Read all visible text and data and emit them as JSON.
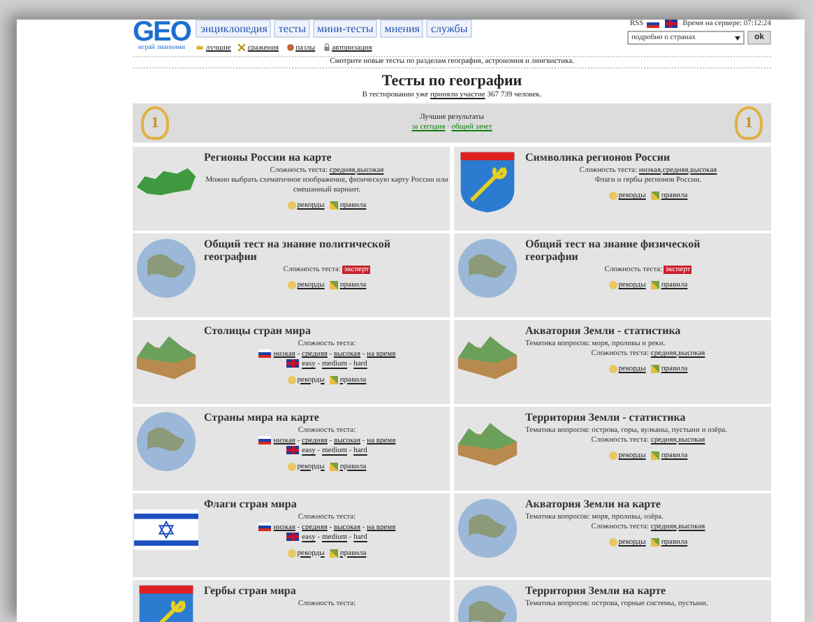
{
  "header": {
    "logo": "GEO",
    "logo_tagline": "играй знаниями",
    "nav": [
      {
        "label": "энциклопедия"
      },
      {
        "label": "тесты"
      },
      {
        "label": "мини-тесты"
      },
      {
        "label": "мнения"
      },
      {
        "label": "службы"
      }
    ],
    "subnav": [
      {
        "kind": "crown",
        "label": "лучшие"
      },
      {
        "kind": "swords",
        "label": "сражения"
      },
      {
        "kind": "puzzle",
        "label": "пазлы"
      },
      {
        "kind": "lock",
        "label": "авторизация"
      }
    ],
    "rss": "RSS",
    "server_time": "Время на сервере: 07:12:24",
    "country_select": "подробно о странах",
    "ok": "ok"
  },
  "notice": "Смотрите новые тесты по разделам география, астрономия и лингвистика.",
  "title": "Тесты по географии",
  "participants": {
    "before": "В тестировании уже",
    "link": "приняли участие",
    "after": "367 739 человек."
  },
  "best_results": {
    "label": "Лучшие результаты",
    "links": [
      "за сегодня",
      "общий зачет"
    ],
    "separator": "·",
    "medals": [
      "1",
      "1"
    ]
  },
  "tests": [
    {
      "kind": "map",
      "title": "Регионы России на карте",
      "difficulty": {
        "kind": "inline",
        "label": "Сложность теста:",
        "separator": ",",
        "links": [
          "средняя",
          "высокая"
        ]
      },
      "note": "Можно выбрать схематичное изображение, физическую карту России или смешанный вариант.",
      "actions": [
        "рекорды",
        "правила"
      ]
    },
    {
      "kind": "emblem",
      "title": "Символика регионов России",
      "difficulty": {
        "kind": "inline",
        "label": "Сложность теста:",
        "separator": ",",
        "links": [
          "низкая",
          "средняя",
          "высокая"
        ]
      },
      "note": "Флаги и гербы регионов России.",
      "actions": [
        "рекорды",
        "правила"
      ]
    },
    {
      "kind": "globe",
      "title": "Общий тест на знание политической географии",
      "difficulty": {
        "kind": "badge",
        "label": "Сложность теста:",
        "links": [
          "эксперт"
        ]
      },
      "actions": [
        "рекорды",
        "правила"
      ]
    },
    {
      "kind": "globe",
      "title": "Общий тест на знание физической географии",
      "difficulty": {
        "kind": "badge",
        "label": "Сложность теста:",
        "links": [
          "эксперт"
        ]
      },
      "actions": [
        "рекорды",
        "правила"
      ]
    },
    {
      "kind": "terrain",
      "title": "Столицы стран мира",
      "difficulty": {
        "kind": "langs",
        "label": "Сложность теста:",
        "rows": [
          {
            "kind": "ru",
            "separator": "-",
            "links": [
              "низкая",
              "средняя",
              "высокая",
              "на время"
            ]
          },
          {
            "kind": "en",
            "separator": "-",
            "links": [
              "easy",
              "medium",
              "hard"
            ]
          }
        ]
      },
      "actions": [
        "рекорды",
        "правила"
      ]
    },
    {
      "kind": "terrain",
      "title": "Акватория Земли - статистика",
      "topics": "Тематика вопросов: моря, проливы и реки.",
      "difficulty": {
        "kind": "inline",
        "label": "Сложность теста:",
        "separator": ",",
        "links": [
          "средняя",
          "высокая"
        ]
      },
      "actions": [
        "рекорды",
        "правила"
      ]
    },
    {
      "kind": "globe",
      "title": "Страны мира на карте",
      "difficulty": {
        "kind": "langs",
        "label": "Сложность теста:",
        "rows": [
          {
            "kind": "ru",
            "separator": "-",
            "links": [
              "низкая",
              "средняя",
              "высокая",
              "на время"
            ]
          },
          {
            "kind": "en",
            "separator": "-",
            "links": [
              "easy",
              "medium",
              "hard"
            ]
          }
        ]
      },
      "actions": [
        "рекорды",
        "правила"
      ]
    },
    {
      "kind": "terrain",
      "title": "Территория Земли - статистика",
      "topics": "Тематика вопросов: острова, горы, вулканы, пустыни и озёра.",
      "difficulty": {
        "kind": "inline",
        "label": "Сложность теста:",
        "separator": ",",
        "links": [
          "средняя",
          "высокая"
        ]
      },
      "actions": [
        "рекорды",
        "правила"
      ]
    },
    {
      "kind": "flag",
      "title": "Флаги стран мира",
      "difficulty": {
        "kind": "langs",
        "label": "Сложность теста:",
        "rows": [
          {
            "kind": "ru",
            "separator": "-",
            "links": [
              "низкая",
              "средняя",
              "высокая",
              "на время"
            ]
          },
          {
            "kind": "en",
            "separator": "-",
            "links": [
              "easy",
              "medium",
              "hard"
            ]
          }
        ]
      },
      "actions": [
        "рекорды",
        "правила"
      ]
    },
    {
      "kind": "globe",
      "title": "Акватория Земли на карте",
      "topics": "Тематика вопросов: моря, проливы, озёра.",
      "difficulty": {
        "kind": "inline",
        "label": "Сложность теста:",
        "separator": ",",
        "links": [
          "средняя",
          "высокая"
        ]
      },
      "actions": [
        "рекорды",
        "правила"
      ]
    },
    {
      "kind": "emblem",
      "title": "Гербы стран мира",
      "difficulty": {
        "kind": "langs",
        "label": "Сложность теста:"
      }
    },
    {
      "kind": "globe",
      "title": "Территория Земли на карте",
      "topics": "Тематика вопросов: острова, горные системы, пустыни."
    }
  ]
}
